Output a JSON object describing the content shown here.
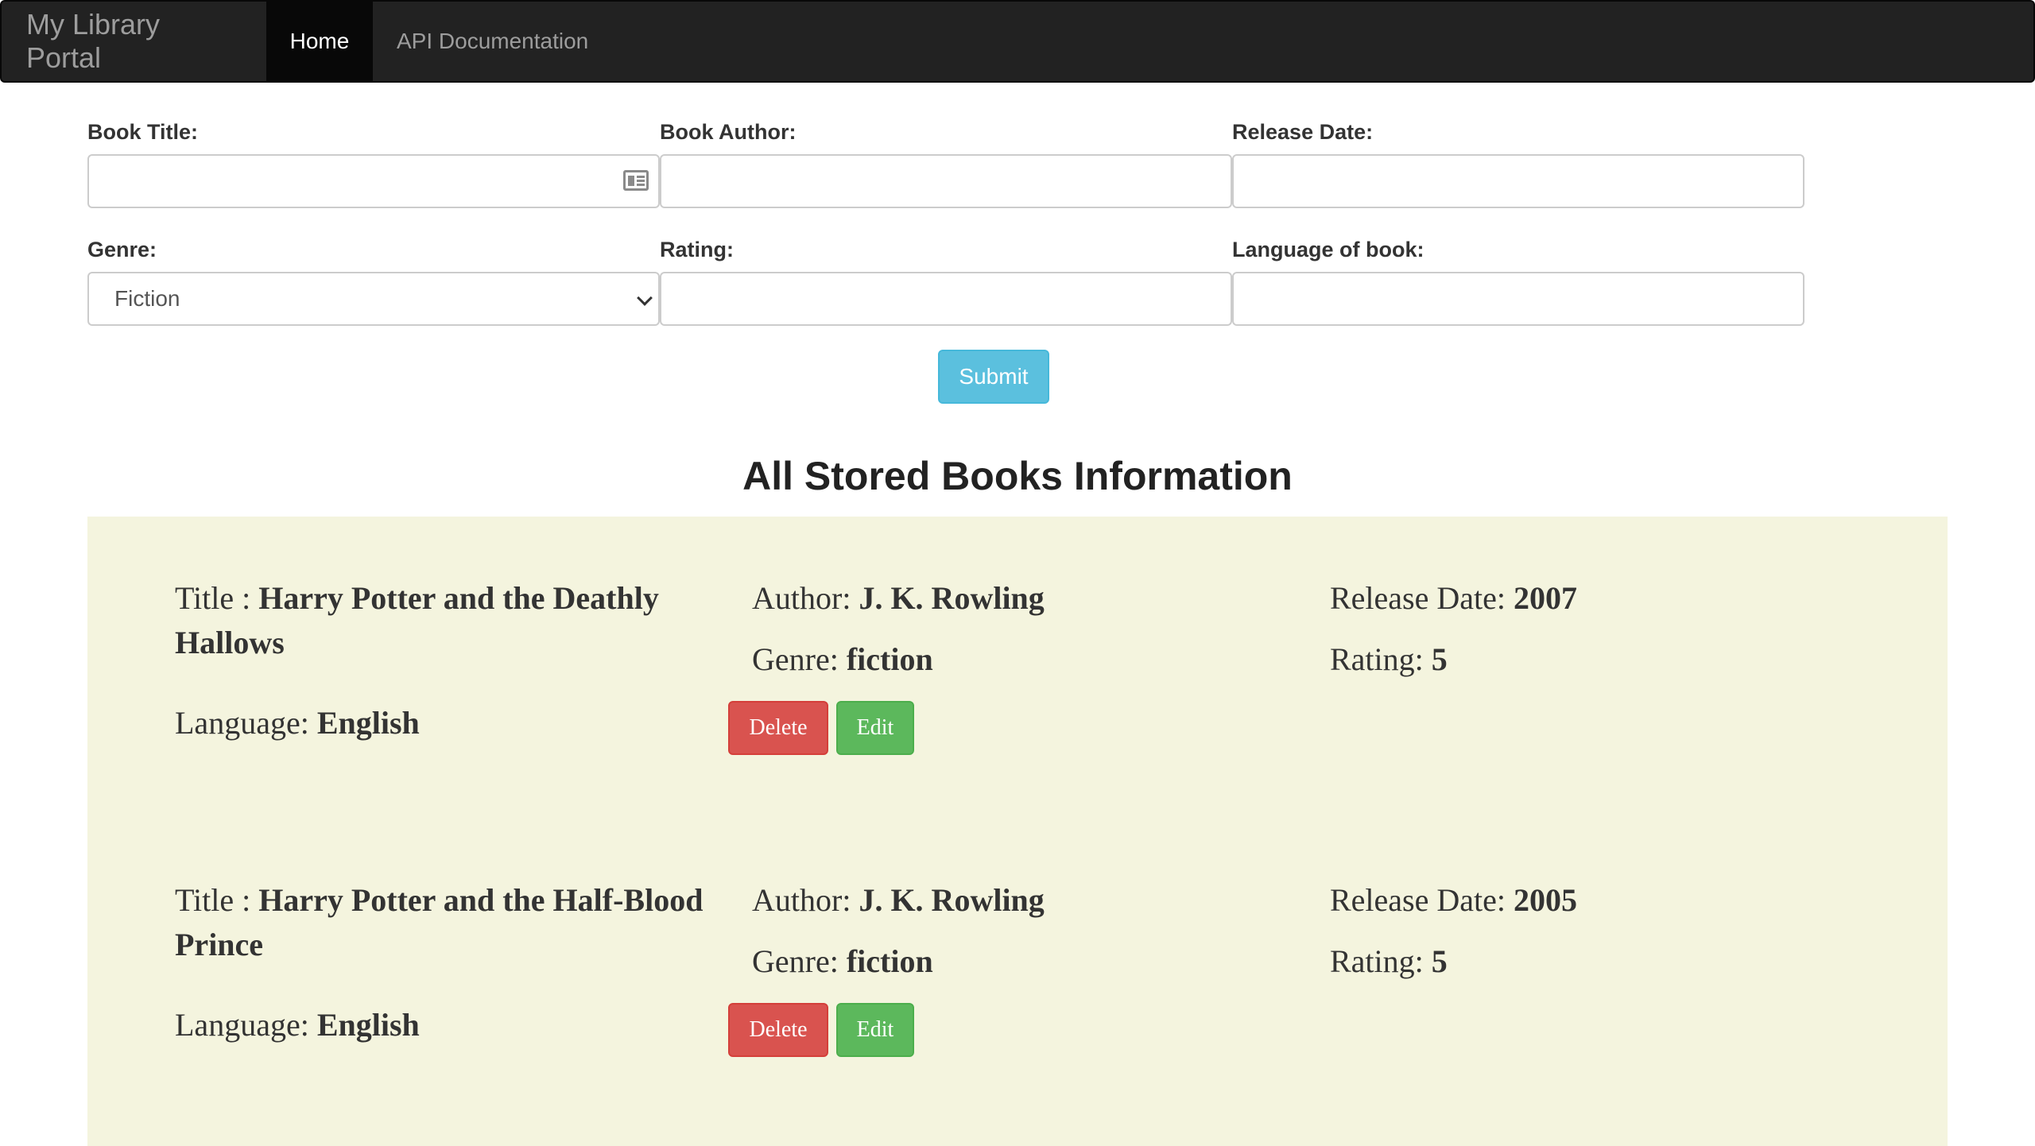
{
  "navbar": {
    "brand": "My Library Portal",
    "links": [
      {
        "label": "Home",
        "active": true
      },
      {
        "label": "API Documentation",
        "active": false
      }
    ]
  },
  "form": {
    "book_title": {
      "label": "Book Title:",
      "value": ""
    },
    "book_author": {
      "label": "Book Author:",
      "value": ""
    },
    "release_date": {
      "label": "Release Date:",
      "value": ""
    },
    "genre": {
      "label": "Genre:",
      "selected": "Fiction"
    },
    "rating": {
      "label": "Rating:",
      "value": ""
    },
    "language": {
      "label": "Language of book:",
      "value": ""
    },
    "submit_label": "Submit"
  },
  "list": {
    "title": "All Stored Books Information",
    "labels": {
      "title": "Title : ",
      "author": "Author: ",
      "release_date": "Release Date: ",
      "genre": "Genre: ",
      "rating": "Rating: ",
      "language": "Language: ",
      "delete": "Delete",
      "edit": "Edit"
    },
    "books": [
      {
        "title": "Harry Potter and the Deathly Hallows",
        "author": "J. K. Rowling",
        "release_date": "2007",
        "genre": "fiction",
        "rating": "5",
        "language": "English"
      },
      {
        "title": "Harry Potter and the Half-Blood Prince",
        "author": "J. K. Rowling",
        "release_date": "2005",
        "genre": "fiction",
        "rating": "5",
        "language": "English"
      }
    ]
  },
  "colors": {
    "navbar_bg": "#222222",
    "submit": "#5bc0de",
    "delete": "#d9534f",
    "edit": "#5cb85c",
    "panel_bg": "#f4f4de"
  },
  "icons": {
    "title_field": "contact-card-icon",
    "genre_select": "chevron-down-icon"
  }
}
